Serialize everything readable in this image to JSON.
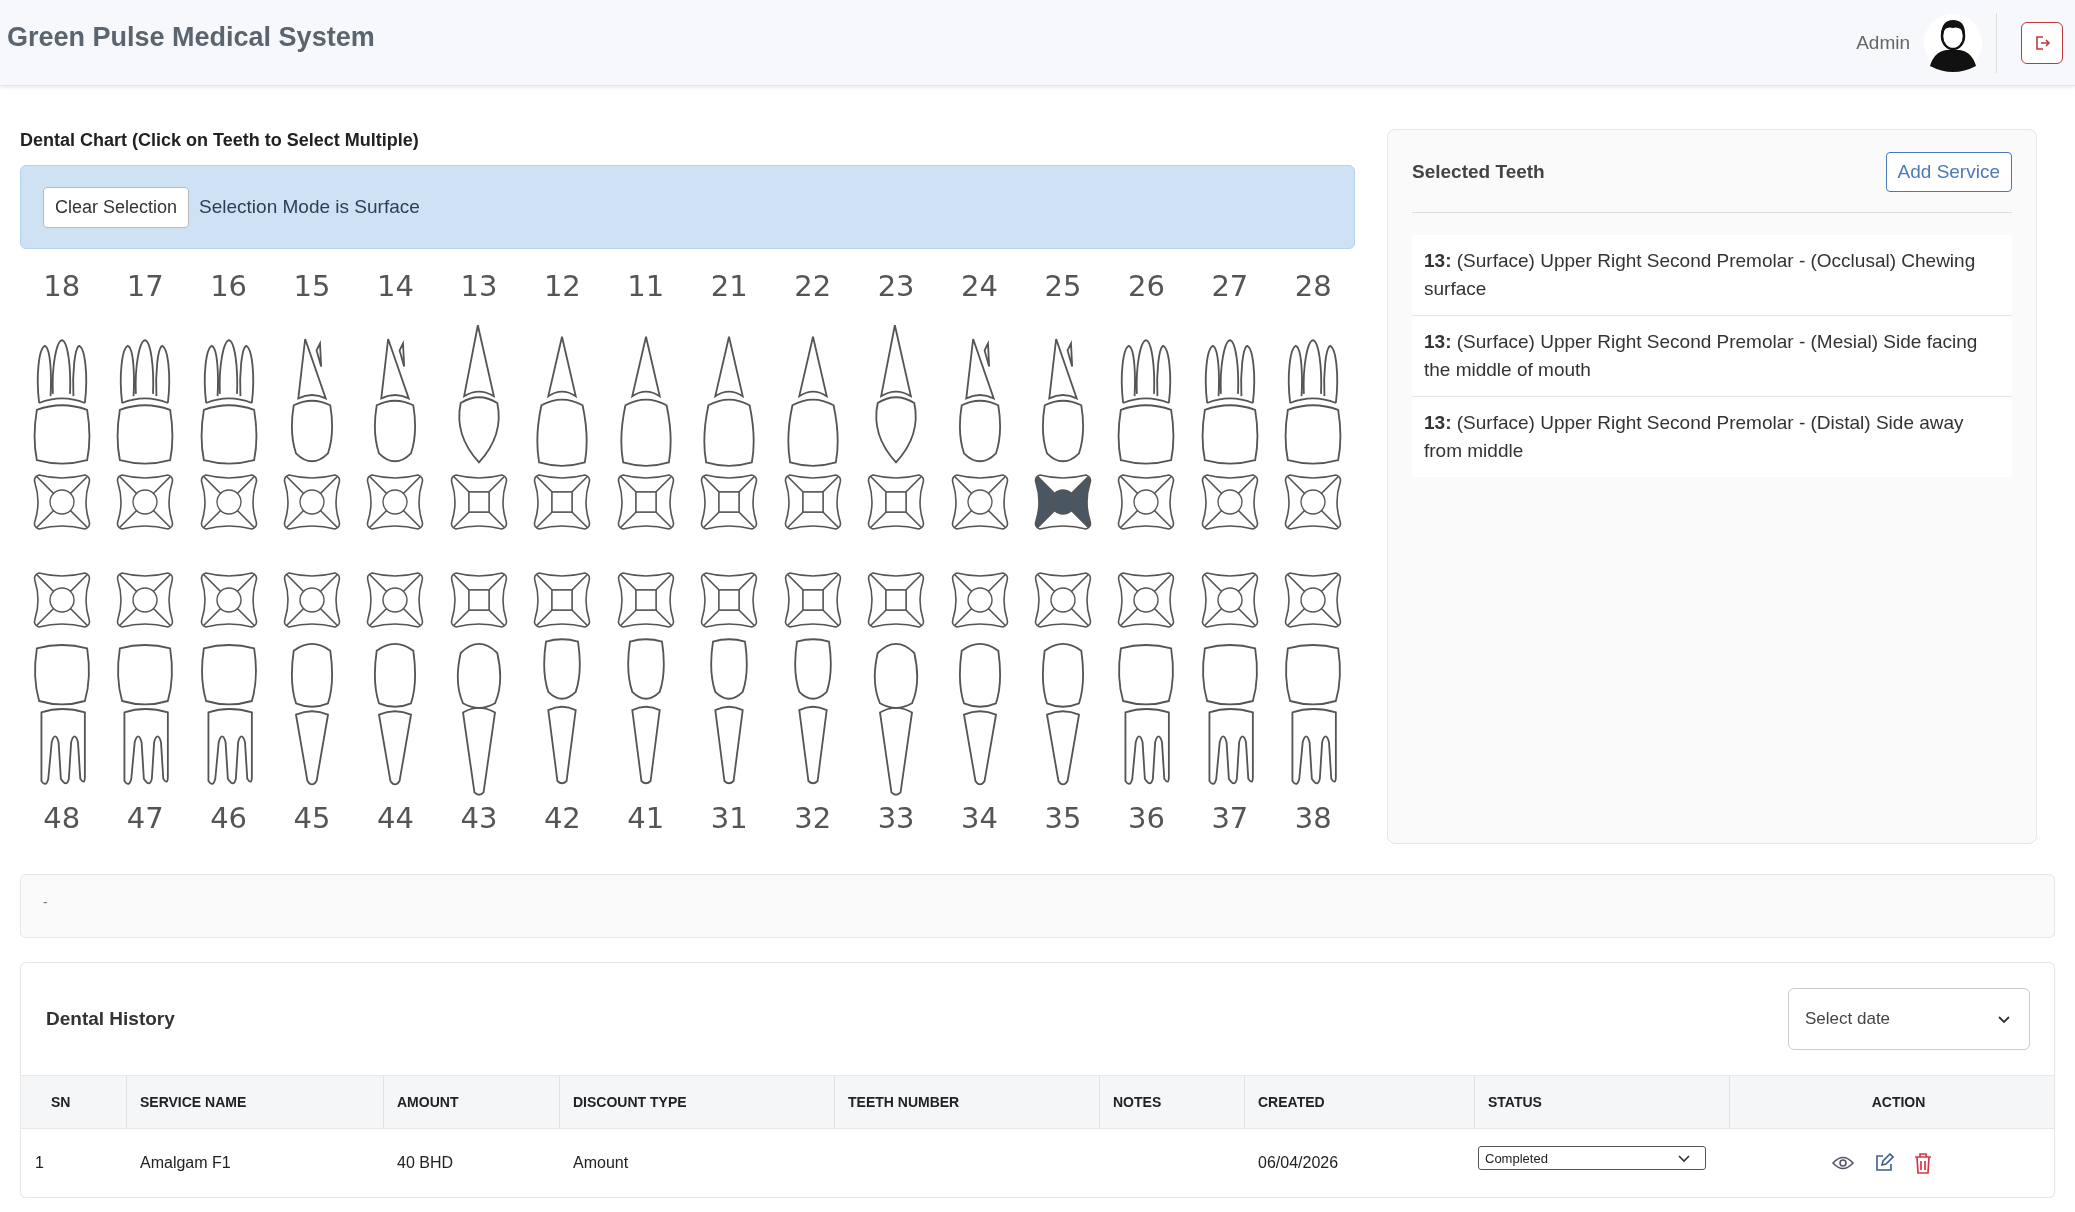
{
  "header": {
    "title": "Green Pulse Medical System",
    "user": "Admin"
  },
  "chart": {
    "title": "Dental Chart (Click on Teeth to Select Multiple)",
    "clear_button": "Clear Selection",
    "mode_text": "Selection Mode is Surface",
    "upper": [
      {
        "number": "18",
        "kind": "molar",
        "surfaces": {
          "occlusal": false,
          "mesial": false,
          "distal": false,
          "buccal": false,
          "lingual": false
        }
      },
      {
        "number": "17",
        "kind": "molar",
        "surfaces": {
          "occlusal": false,
          "mesial": false,
          "distal": false,
          "buccal": false,
          "lingual": false
        }
      },
      {
        "number": "16",
        "kind": "molar",
        "surfaces": {
          "occlusal": false,
          "mesial": false,
          "distal": false,
          "buccal": false,
          "lingual": false
        }
      },
      {
        "number": "15",
        "kind": "premolar",
        "surfaces": {
          "occlusal": false,
          "mesial": false,
          "distal": false,
          "buccal": false,
          "lingual": false
        }
      },
      {
        "number": "14",
        "kind": "premolar",
        "surfaces": {
          "occlusal": false,
          "mesial": false,
          "distal": false,
          "buccal": false,
          "lingual": false
        }
      },
      {
        "number": "13",
        "kind": "canine",
        "surfaces": {
          "occlusal": false,
          "mesial": false,
          "distal": false,
          "buccal": false,
          "lingual": false
        }
      },
      {
        "number": "12",
        "kind": "incisor",
        "surfaces": {
          "occlusal": false,
          "mesial": false,
          "distal": false,
          "buccal": false,
          "lingual": false
        }
      },
      {
        "number": "11",
        "kind": "incisor",
        "surfaces": {
          "occlusal": false,
          "mesial": false,
          "distal": false,
          "buccal": false,
          "lingual": false
        }
      },
      {
        "number": "21",
        "kind": "incisor",
        "surfaces": {
          "occlusal": false,
          "mesial": false,
          "distal": false,
          "buccal": false,
          "lingual": false
        }
      },
      {
        "number": "22",
        "kind": "incisor",
        "surfaces": {
          "occlusal": false,
          "mesial": false,
          "distal": false,
          "buccal": false,
          "lingual": false
        }
      },
      {
        "number": "23",
        "kind": "canine",
        "surfaces": {
          "occlusal": false,
          "mesial": false,
          "distal": false,
          "buccal": false,
          "lingual": false
        }
      },
      {
        "number": "24",
        "kind": "premolar",
        "surfaces": {
          "occlusal": false,
          "mesial": false,
          "distal": false,
          "buccal": false,
          "lingual": false
        }
      },
      {
        "number": "25",
        "kind": "premolar",
        "surfaces": {
          "occlusal": true,
          "mesial": true,
          "distal": true,
          "buccal": false,
          "lingual": false
        }
      },
      {
        "number": "26",
        "kind": "molar",
        "surfaces": {
          "occlusal": false,
          "mesial": false,
          "distal": false,
          "buccal": false,
          "lingual": false
        }
      },
      {
        "number": "27",
        "kind": "molar",
        "surfaces": {
          "occlusal": false,
          "mesial": false,
          "distal": false,
          "buccal": false,
          "lingual": false
        }
      },
      {
        "number": "28",
        "kind": "molar",
        "surfaces": {
          "occlusal": false,
          "mesial": false,
          "distal": false,
          "buccal": false,
          "lingual": false
        }
      }
    ],
    "lower": [
      {
        "number": "48",
        "kind": "molar",
        "surfaces": {
          "occlusal": false,
          "mesial": false,
          "distal": false,
          "buccal": false,
          "lingual": false
        }
      },
      {
        "number": "47",
        "kind": "molar",
        "surfaces": {
          "occlusal": false,
          "mesial": false,
          "distal": false,
          "buccal": false,
          "lingual": false
        }
      },
      {
        "number": "46",
        "kind": "molar",
        "surfaces": {
          "occlusal": false,
          "mesial": false,
          "distal": false,
          "buccal": false,
          "lingual": false
        }
      },
      {
        "number": "45",
        "kind": "premolar",
        "surfaces": {
          "occlusal": false,
          "mesial": false,
          "distal": false,
          "buccal": false,
          "lingual": false
        }
      },
      {
        "number": "44",
        "kind": "premolar",
        "surfaces": {
          "occlusal": false,
          "mesial": false,
          "distal": false,
          "buccal": false,
          "lingual": false
        }
      },
      {
        "number": "43",
        "kind": "canine",
        "surfaces": {
          "occlusal": false,
          "mesial": false,
          "distal": false,
          "buccal": false,
          "lingual": false
        }
      },
      {
        "number": "42",
        "kind": "incisor",
        "surfaces": {
          "occlusal": false,
          "mesial": false,
          "distal": false,
          "buccal": false,
          "lingual": false
        }
      },
      {
        "number": "41",
        "kind": "incisor",
        "surfaces": {
          "occlusal": false,
          "mesial": false,
          "distal": false,
          "buccal": false,
          "lingual": false
        }
      },
      {
        "number": "31",
        "kind": "incisor",
        "surfaces": {
          "occlusal": false,
          "mesial": false,
          "distal": false,
          "buccal": false,
          "lingual": false
        }
      },
      {
        "number": "32",
        "kind": "incisor",
        "surfaces": {
          "occlusal": false,
          "mesial": false,
          "distal": false,
          "buccal": false,
          "lingual": false
        }
      },
      {
        "number": "33",
        "kind": "canine",
        "surfaces": {
          "occlusal": false,
          "mesial": false,
          "distal": false,
          "buccal": false,
          "lingual": false
        }
      },
      {
        "number": "34",
        "kind": "premolar",
        "surfaces": {
          "occlusal": false,
          "mesial": false,
          "distal": false,
          "buccal": false,
          "lingual": false
        }
      },
      {
        "number": "35",
        "kind": "premolar",
        "surfaces": {
          "occlusal": false,
          "mesial": false,
          "distal": false,
          "buccal": false,
          "lingual": false
        }
      },
      {
        "number": "36",
        "kind": "molar",
        "surfaces": {
          "occlusal": false,
          "mesial": false,
          "distal": false,
          "buccal": false,
          "lingual": false
        }
      },
      {
        "number": "37",
        "kind": "molar",
        "surfaces": {
          "occlusal": false,
          "mesial": false,
          "distal": false,
          "buccal": false,
          "lingual": false
        }
      },
      {
        "number": "38",
        "kind": "molar",
        "surfaces": {
          "occlusal": false,
          "mesial": false,
          "distal": false,
          "buccal": false,
          "lingual": false
        }
      }
    ]
  },
  "selected_panel": {
    "title": "Selected Teeth",
    "add_button": "Add Service",
    "items": [
      {
        "text": "**13:** (Surface) Upper Right Second Premolar - (Occlusal) Chewing surface"
      },
      {
        "text": "**13:** (Surface) Upper Right Second Premolar - (Mesial) Side facing the middle of mouth"
      },
      {
        "text": "**13:** (Surface) Upper Right Second Premolar - (Distal) Side away from middle"
      }
    ]
  },
  "notes": "-",
  "history": {
    "title": "Dental History",
    "date_select": {
      "placeholder": "Select date"
    },
    "columns": [
      "SN",
      "SERVICE NAME",
      "AMOUNT",
      "DISCOUNT TYPE",
      "TEETH NUMBER",
      "NOTES",
      "CREATED",
      "STATUS",
      "ACTION"
    ],
    "rows": [
      {
        "sn": "1",
        "service_name": "Amalgam F1",
        "amount": "40 BHD",
        "discount_type": "Amount",
        "created": "06/04/2026",
        "status": "Completed"
      }
    ]
  }
}
